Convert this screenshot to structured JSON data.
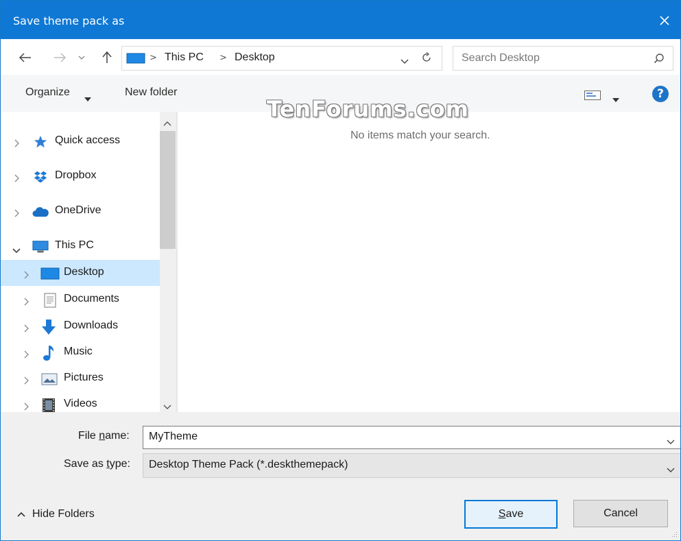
{
  "window": {
    "title": "Save theme pack as"
  },
  "address_bar": {
    "crumbs": [
      "This PC",
      "Desktop"
    ],
    "separator": ">"
  },
  "search": {
    "placeholder": "Search Desktop"
  },
  "toolbar": {
    "organize_label": "Organize",
    "new_folder_label": "New folder"
  },
  "watermark": "TenForums.com",
  "content": {
    "empty_message": "No items match your search."
  },
  "nav_tree": [
    {
      "label": "Quick access",
      "icon": "star-icon",
      "expanded": false,
      "level": 0
    },
    {
      "label": "Dropbox",
      "icon": "dropbox-icon",
      "expanded": false,
      "level": 0
    },
    {
      "label": "OneDrive",
      "icon": "cloud-icon",
      "expanded": false,
      "level": 0
    },
    {
      "label": "This PC",
      "icon": "computer-icon",
      "expanded": true,
      "level": 0
    },
    {
      "label": "Desktop",
      "icon": "desktop-folder-icon",
      "expanded": false,
      "level": 1,
      "selected": true
    },
    {
      "label": "Documents",
      "icon": "documents-icon",
      "expanded": false,
      "level": 1
    },
    {
      "label": "Downloads",
      "icon": "download-arrow-icon",
      "expanded": false,
      "level": 1
    },
    {
      "label": "Music",
      "icon": "music-note-icon",
      "expanded": false,
      "level": 1
    },
    {
      "label": "Pictures",
      "icon": "pictures-icon",
      "expanded": false,
      "level": 1
    },
    {
      "label": "Videos",
      "icon": "film-icon",
      "expanded": false,
      "level": 1
    }
  ],
  "form": {
    "file_name_label_pre": "File ",
    "file_name_label_u": "n",
    "file_name_label_post": "ame:",
    "file_name_value": "MyTheme",
    "save_type_label_pre": "Save as ",
    "save_type_label_u": "t",
    "save_type_label_post": "ype:",
    "save_type_value": "Desktop Theme Pack (*.deskthemepack)"
  },
  "footer": {
    "hide_folders_label": "Hide Folders",
    "save_label_u": "S",
    "save_label_rest": "ave",
    "cancel_label": "Cancel"
  },
  "colors": {
    "titlebar": "#0f78d4",
    "selection": "#cce8ff",
    "accent": "#0078d7"
  }
}
